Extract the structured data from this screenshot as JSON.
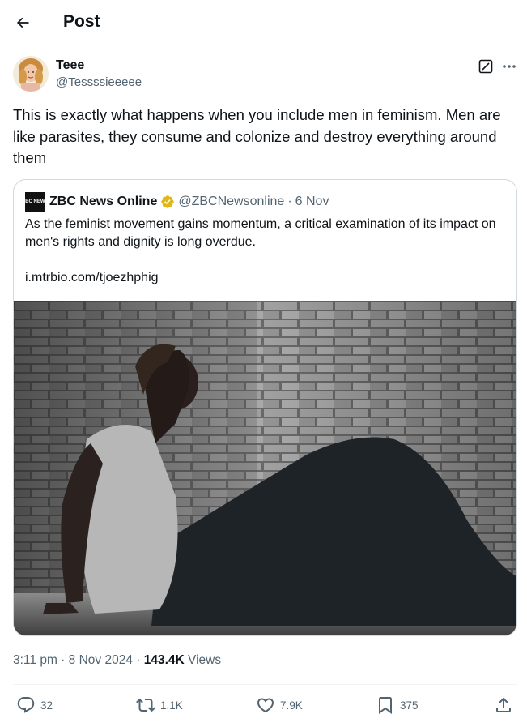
{
  "header": {
    "title": "Post"
  },
  "post": {
    "author": {
      "name": "Teee",
      "handle": "@Tessssieeeee"
    },
    "text": "This is exactly what happens when you include men in feminism. Men are like parasites, they consume and colonize and destroy everything around them",
    "quoted": {
      "logo_text": "ZBC NEWS",
      "name": "ZBC News Online",
      "handle": "@ZBCNewsonline",
      "separator": "·",
      "date": "6 Nov",
      "text": "As the feminist movement gains momentum, a critical examination of its impact on men's rights and dignity is long overdue.",
      "link": "i.mtrbio.com/tjoezhphig"
    },
    "meta": {
      "time": "3:11 pm",
      "sep1": "·",
      "date": "8 Nov 2024",
      "sep2": "·",
      "views_count": "143.4K",
      "views_label": "Views"
    },
    "actions": {
      "replies": "32",
      "reposts": "1.1K",
      "likes": "7.9K",
      "bookmarks": "375"
    }
  },
  "colors": {
    "text_primary": "#0f1419",
    "text_secondary": "#536471",
    "border": "#cfd9de",
    "verified_gold": "#e2b719"
  },
  "icons": [
    "back-arrow-icon",
    "grok-icon",
    "more-icon",
    "verified-gold-icon",
    "reply-icon",
    "repost-icon",
    "like-icon",
    "bookmark-icon",
    "share-icon"
  ]
}
